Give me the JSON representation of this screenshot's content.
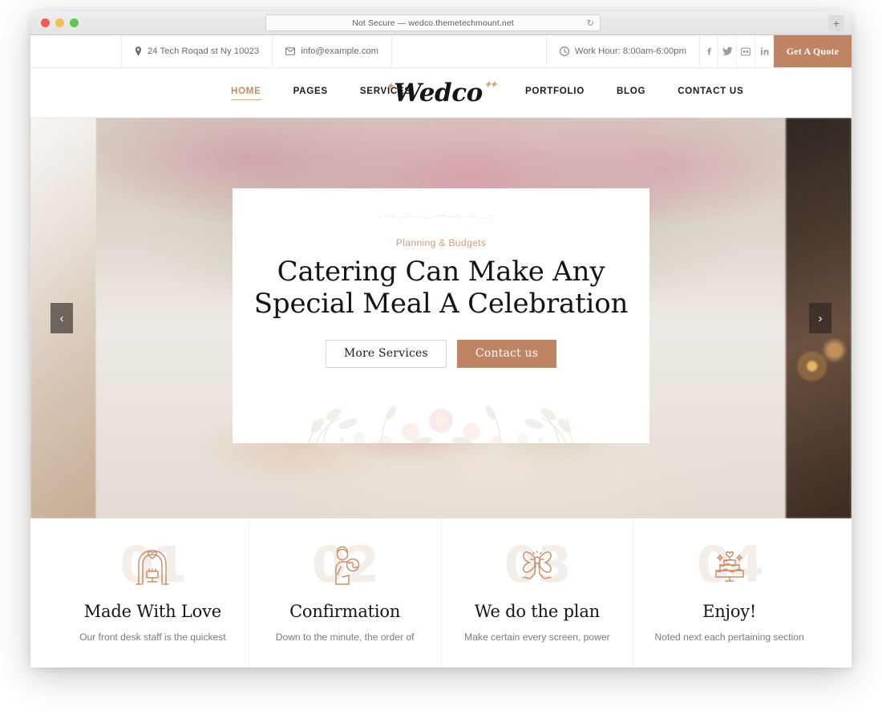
{
  "browser": {
    "url_text": "Not Secure — wedco.themetechmount.net",
    "reload_icon": "reload-icon",
    "newtab_label": "+"
  },
  "topbar": {
    "address": "24 Tech Roqad st Ny 10023",
    "email": "info@example.com",
    "work_hour": "Work Hour: 8:00am-6:00pm",
    "social": [
      {
        "name": "facebook-icon",
        "glyph": "f"
      },
      {
        "name": "twitter-icon",
        "glyph": "t"
      },
      {
        "name": "flickr-icon",
        "glyph": "fl"
      },
      {
        "name": "linkedin-icon",
        "glyph": "in"
      }
    ],
    "quote_label": "Get A Quote"
  },
  "nav": {
    "left": [
      {
        "label": "HOME",
        "active": true
      },
      {
        "label": "PAGES",
        "active": false
      },
      {
        "label": "SERVICES",
        "active": false
      }
    ],
    "right": [
      {
        "label": "PORTFOLIO",
        "active": false
      },
      {
        "label": "BLOG",
        "active": false
      },
      {
        "label": "CONTACT US",
        "active": false
      }
    ],
    "logo": "Wedco"
  },
  "hero": {
    "prev_label": "‹",
    "next_label": "›",
    "eyebrow": "Planning & Budgets",
    "title_line1": "Catering Can Make Any",
    "title_line2": "Special Meal A Celebration",
    "btn_primary": "More Services",
    "btn_secondary": "Contact us"
  },
  "features": [
    {
      "number": "01",
      "icon": "wedding-arch-icon",
      "title": "Made With Love",
      "desc": "Our front desk staff is the quickest"
    },
    {
      "number": "02",
      "icon": "phone-call-person-icon",
      "title": "Confirmation",
      "desc": "Down to the minute, the order of"
    },
    {
      "number": "03",
      "icon": "ribbon-bow-icon",
      "title": "We do the plan",
      "desc": "Make certain every screen, power"
    },
    {
      "number": "04",
      "icon": "wedding-cake-icon",
      "title": "Enjoy!",
      "desc": "Noted next each pertaining section"
    }
  ],
  "colors": {
    "accent": "#bf8464",
    "accent_light": "#c9a182",
    "text_dark": "#141414",
    "muted": "#7b7b7b"
  }
}
